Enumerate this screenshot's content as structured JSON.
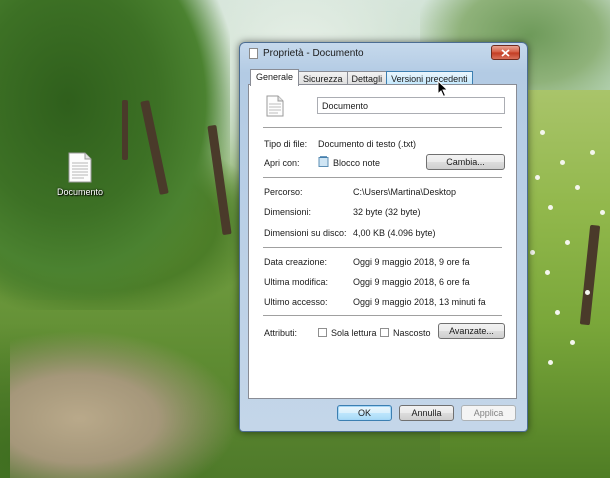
{
  "desktop": {
    "icon_label": "Documento"
  },
  "dialog": {
    "title": "Proprietà - Documento",
    "tabs": [
      {
        "label": "Generale",
        "active": true
      },
      {
        "label": "Sicurezza",
        "active": false
      },
      {
        "label": "Dettagli",
        "active": false
      },
      {
        "label": "Versioni precedenti",
        "active": false,
        "hover": true
      }
    ],
    "file_name": "Documento",
    "type_label": "Tipo di file:",
    "type_value": "Documento di testo (.txt)",
    "open_with_label": "Apri con:",
    "open_with_value": "Blocco note",
    "change_button": "Cambia...",
    "location_label": "Percorso:",
    "location_value": "C:\\Users\\Martina\\Desktop",
    "size_label": "Dimensioni:",
    "size_value": "32 byte (32 byte)",
    "size_on_disk_label": "Dimensioni su disco:",
    "size_on_disk_value": "4,00 KB (4.096 byte)",
    "created_label": "Data creazione:",
    "created_value": "Oggi 9 maggio 2018, 9 ore fa",
    "modified_label": "Ultima modifica:",
    "modified_value": "Oggi 9 maggio 2018, 6 ore fa",
    "accessed_label": "Ultimo accesso:",
    "accessed_value": "Oggi 9 maggio 2018, 13 minuti fa",
    "attributes_label": "Attributi:",
    "readonly_label": "Sola lettura",
    "hidden_label": "Nascosto",
    "advanced_button": "Avanzate...",
    "ok_button": "OK",
    "cancel_button": "Annulla",
    "apply_button": "Applica"
  }
}
